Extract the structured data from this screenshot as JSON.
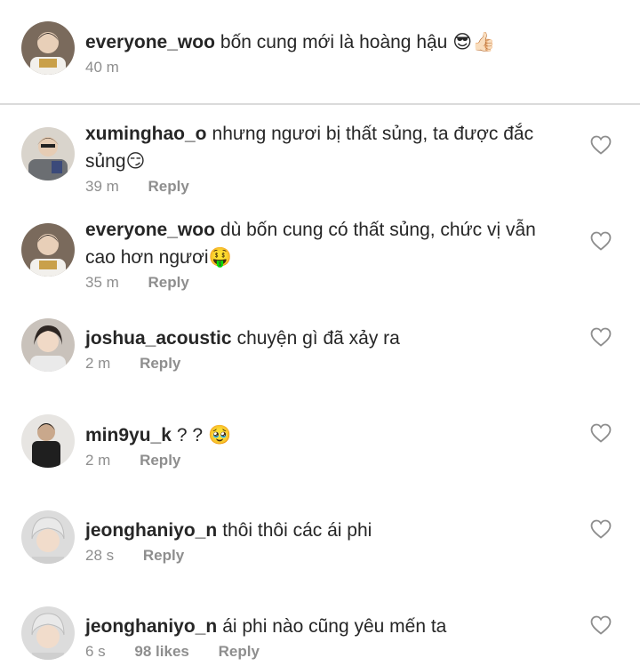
{
  "caption": {
    "username": "everyone_woo",
    "text": "bốn cung mới là hoàng hậu",
    "emoji": "😎👍🏻",
    "time": "40 m"
  },
  "comments": [
    {
      "username": "xuminghao_o",
      "text": "nhưng ngươi bị thất sủng, ta được đắc sủng",
      "emoji": "😏",
      "time": "39 m",
      "reply_label": "Reply"
    },
    {
      "username": "everyone_woo",
      "text": "dù bốn cung có thất sủng, chức vị vẫn cao hơn ngươi",
      "emoji": "🤑",
      "time": "35 m",
      "reply_label": "Reply"
    },
    {
      "username": "joshua_acoustic",
      "text": "chuyện gì đã xảy ra",
      "emoji": "",
      "time": "2 m",
      "reply_label": "Reply"
    },
    {
      "username": "min9yu_k",
      "text": "? ?",
      "emoji": "🥹",
      "time": "2 m",
      "reply_label": "Reply"
    },
    {
      "username": "jeonghaniyo_n",
      "text": "thôi thôi các ái phi",
      "emoji": "",
      "time": "28 s",
      "reply_label": "Reply"
    },
    {
      "username": "jeonghaniyo_n",
      "text": "ái phi nào cũng yêu mến ta",
      "emoji": "",
      "time": "6 s",
      "likes": "98 likes",
      "reply_label": "Reply"
    }
  ],
  "icons": {
    "like": "heart-outline-icon"
  },
  "colors": {
    "text": "#262626",
    "secondary": "#8e8e8e",
    "divider": "#dbdbdb"
  }
}
